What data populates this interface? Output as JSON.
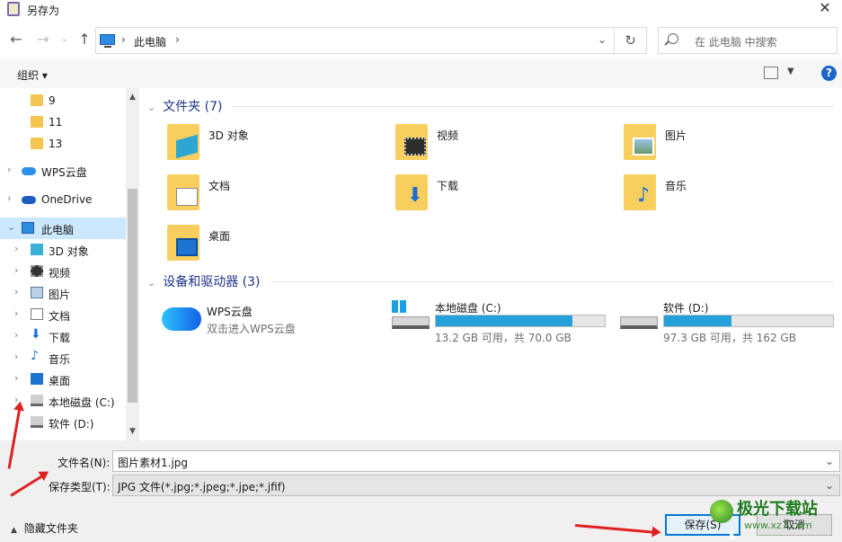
{
  "window": {
    "title": "另存为"
  },
  "address": {
    "crumb": "此电脑",
    "sep1": "›",
    "sep2": "›"
  },
  "search": {
    "placeholder": "在 此电脑 中搜索"
  },
  "toolbar": {
    "organize": "组织 ▾",
    "help": "?"
  },
  "nav": {
    "items": [
      {
        "label": "9",
        "icon": "folder-icon"
      },
      {
        "label": "11",
        "icon": "folder-icon"
      },
      {
        "label": "13",
        "icon": "folder-icon"
      },
      {
        "label": "WPS云盘",
        "icon": "cloud-icon"
      },
      {
        "label": "OneDrive",
        "icon": "cloud-icon"
      },
      {
        "label": "此电脑",
        "icon": "computer-icon",
        "selected": true
      },
      {
        "label": "3D 对象",
        "icon": "cube-icon"
      },
      {
        "label": "视频",
        "icon": "film-icon"
      },
      {
        "label": "图片",
        "icon": "picture-icon"
      },
      {
        "label": "文档",
        "icon": "document-icon"
      },
      {
        "label": "下载",
        "icon": "download-icon"
      },
      {
        "label": "音乐",
        "icon": "music-icon"
      },
      {
        "label": "桌面",
        "icon": "desktop-icon"
      },
      {
        "label": "本地磁盘 (C:)",
        "icon": "drive-icon"
      },
      {
        "label": "软件 (D:)",
        "icon": "drive-icon"
      }
    ]
  },
  "main": {
    "folders_header": "文件夹 (7)",
    "folders": [
      {
        "name": "3D 对象",
        "icon": "cube-icon"
      },
      {
        "name": "视频",
        "icon": "film-icon"
      },
      {
        "name": "图片",
        "icon": "picture-icon"
      },
      {
        "name": "文档",
        "icon": "document-icon"
      },
      {
        "name": "下载",
        "icon": "download-icon"
      },
      {
        "name": "音乐",
        "icon": "music-icon"
      },
      {
        "name": "桌面",
        "icon": "desktop-icon"
      }
    ],
    "devices_header": "设备和驱动器 (3)",
    "devices": [
      {
        "name": "WPS云盘",
        "sub": "双击进入WPS云盘"
      },
      {
        "name": "本地磁盘 (C:)",
        "sub": "13.2 GB 可用，共 70.0 GB",
        "used_fraction": 0.81
      },
      {
        "name": "软件 (D:)",
        "sub": "97.3 GB 可用，共 162 GB",
        "used_fraction": 0.4
      }
    ]
  },
  "form": {
    "filename_label": "文件名(N):",
    "filename_value": "图片素材1.jpg",
    "filetype_label": "保存类型(T):",
    "filetype_value": "JPG 文件(*.jpg;*.jpeg;*.jpe;*.jfif)",
    "hide_folders": "隐藏文件夹",
    "save": "保存(S)",
    "cancel": "取消"
  },
  "watermark": {
    "brand": "极光下载站",
    "url": "www.xz7.com"
  },
  "colors": {
    "accent": "#0078d7",
    "nav_selected": "#cce8ff",
    "bar_fill": "#26a0da",
    "annotation": "#e02020"
  }
}
